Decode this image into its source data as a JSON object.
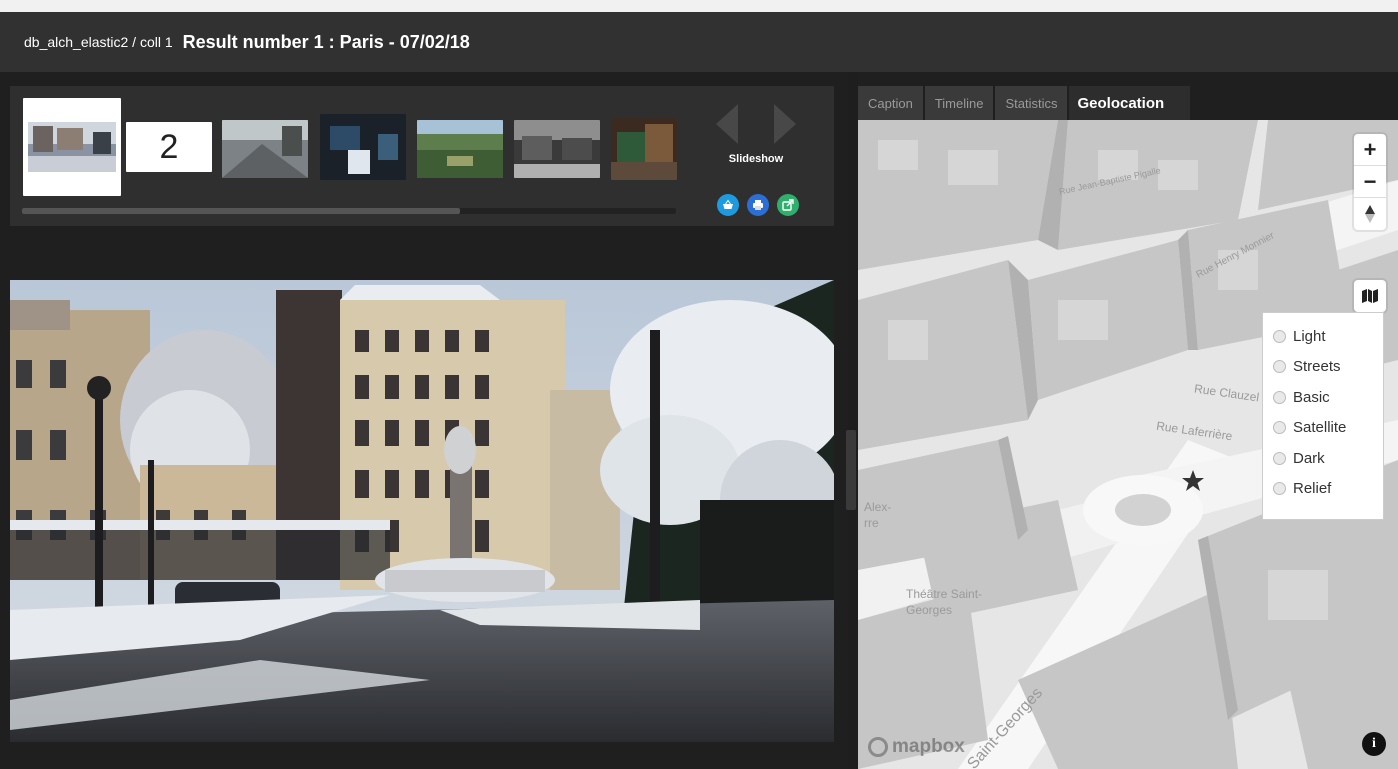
{
  "header": {
    "collection": "db_alch_elastic2 / coll 1",
    "result_title": "Result number 1 : Paris - 07/02/18"
  },
  "thumbnails": {
    "numbered_thumb": "2",
    "slideshow_label": "Slideshow",
    "scroll_fraction": 0.67,
    "action_icons": [
      "basket-icon",
      "print-icon",
      "share-icon"
    ],
    "action_colors": [
      "#1e9be0",
      "#2b6fd6",
      "#2fae6e"
    ]
  },
  "tabs": [
    {
      "label": "Caption",
      "active": false
    },
    {
      "label": "Timeline",
      "active": false
    },
    {
      "label": "Statistics",
      "active": false
    },
    {
      "label": "Geolocation",
      "active": true
    }
  ],
  "map": {
    "zoom_in": "+",
    "zoom_out": "−",
    "layer_options": [
      "Light",
      "Streets",
      "Basic",
      "Satellite",
      "Dark",
      "Relief"
    ],
    "attribution": "mapbox",
    "info": "i",
    "street_labels": [
      "Rue Clauzel",
      "Rue Laferrière",
      "Rue Henry Monnier",
      "Rue Jean-Baptiste Pigalle",
      "Théâtre Saint-Georges",
      "Alex-",
      "rre",
      "Saint-Georges"
    ],
    "marker_icon": "star-marker-icon"
  }
}
